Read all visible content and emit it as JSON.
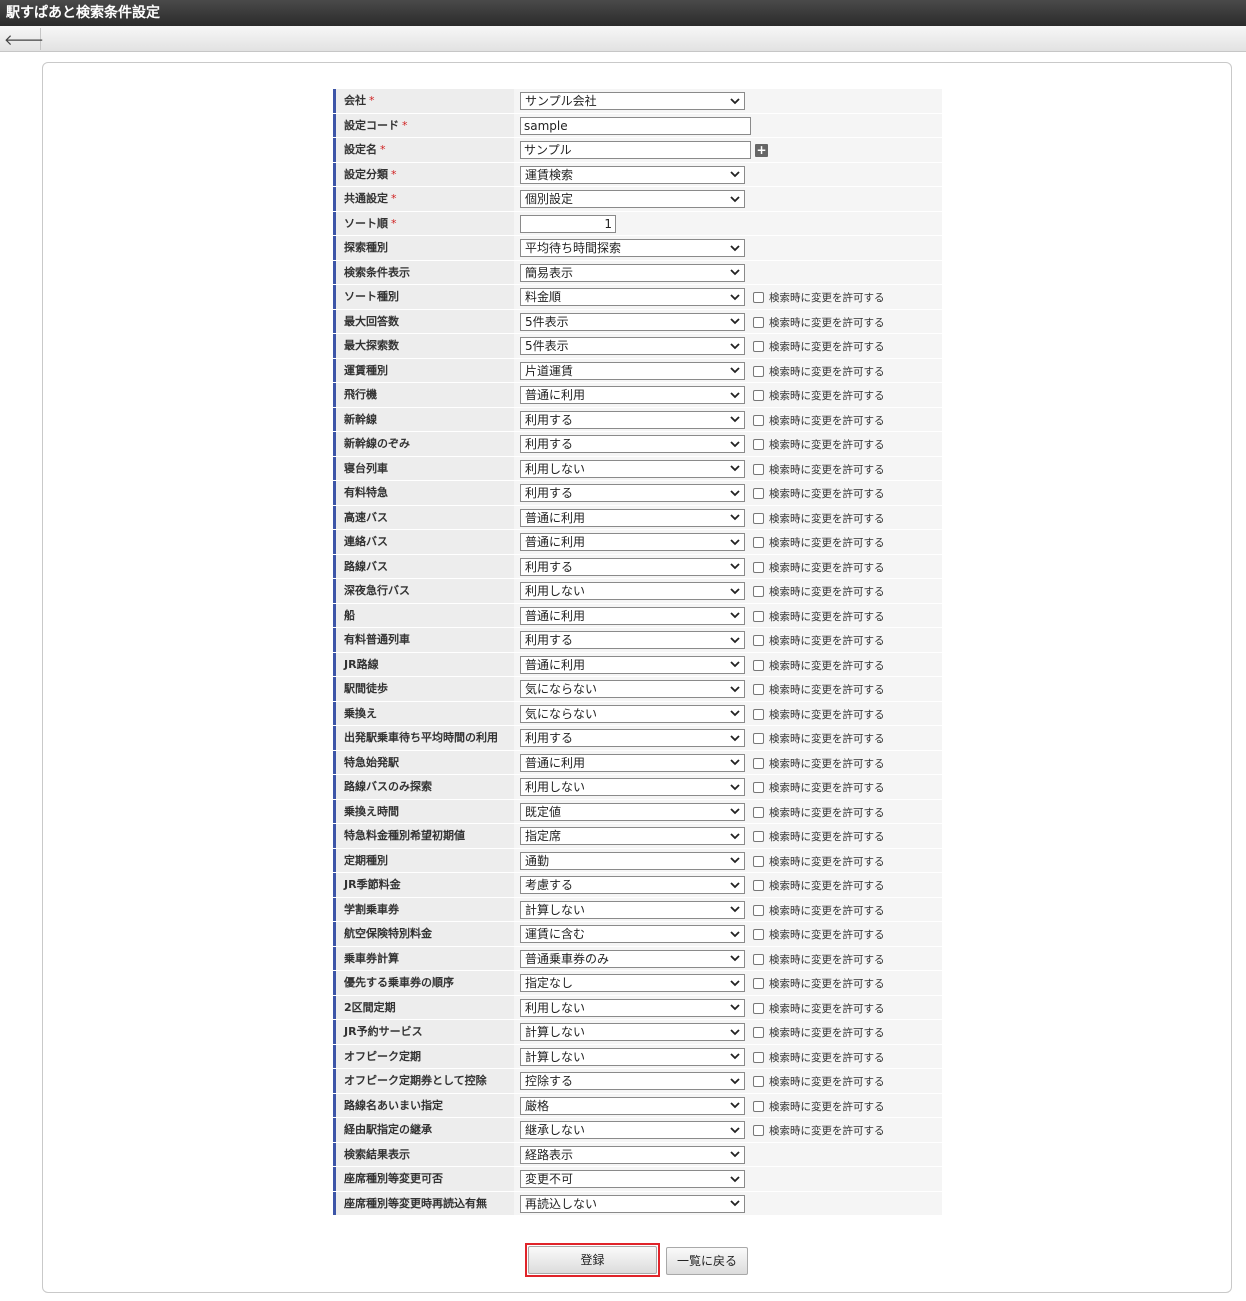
{
  "window": {
    "title": "駅すぱあと検索条件設定"
  },
  "toolbar": {
    "back_icon": "arrow-left-icon",
    "back_glyph": "🡐"
  },
  "allow_change_label": "検索時に変更を許可する",
  "rows": [
    {
      "label": "会社",
      "required": true,
      "type": "select",
      "value": "サンプル会社",
      "allow": false
    },
    {
      "label": "設定コード",
      "required": true,
      "type": "text",
      "value": "sample",
      "allow": false
    },
    {
      "label": "設定名",
      "required": true,
      "type": "text-plus",
      "value": "サンプル",
      "allow": false
    },
    {
      "label": "設定分類",
      "required": true,
      "type": "select",
      "value": "運賃検索",
      "allow": false
    },
    {
      "label": "共通設定",
      "required": true,
      "type": "select",
      "value": "個別設定",
      "allow": false
    },
    {
      "label": "ソート順",
      "required": true,
      "type": "number",
      "value": "1",
      "allow": false
    },
    {
      "label": "探索種別",
      "required": false,
      "type": "select",
      "value": "平均待ち時間探索",
      "allow": false
    },
    {
      "label": "検索条件表示",
      "required": false,
      "type": "select",
      "value": "簡易表示",
      "allow": false
    },
    {
      "label": "ソート種別",
      "required": false,
      "type": "select",
      "value": "料金順",
      "allow": true
    },
    {
      "label": "最大回答数",
      "required": false,
      "type": "select",
      "value": "5件表示",
      "allow": true
    },
    {
      "label": "最大探索数",
      "required": false,
      "type": "select",
      "value": "5件表示",
      "allow": true
    },
    {
      "label": "運賃種別",
      "required": false,
      "type": "select",
      "value": "片道運賃",
      "allow": true
    },
    {
      "label": "飛行機",
      "required": false,
      "type": "select",
      "value": "普通に利用",
      "allow": true
    },
    {
      "label": "新幹線",
      "required": false,
      "type": "select",
      "value": "利用する",
      "allow": true
    },
    {
      "label": "新幹線のぞみ",
      "required": false,
      "type": "select",
      "value": "利用する",
      "allow": true
    },
    {
      "label": "寝台列車",
      "required": false,
      "type": "select",
      "value": "利用しない",
      "allow": true
    },
    {
      "label": "有料特急",
      "required": false,
      "type": "select",
      "value": "利用する",
      "allow": true
    },
    {
      "label": "高速バス",
      "required": false,
      "type": "select",
      "value": "普通に利用",
      "allow": true
    },
    {
      "label": "連絡バス",
      "required": false,
      "type": "select",
      "value": "普通に利用",
      "allow": true
    },
    {
      "label": "路線バス",
      "required": false,
      "type": "select",
      "value": "利用する",
      "allow": true
    },
    {
      "label": "深夜急行バス",
      "required": false,
      "type": "select",
      "value": "利用しない",
      "allow": true
    },
    {
      "label": "船",
      "required": false,
      "type": "select",
      "value": "普通に利用",
      "allow": true
    },
    {
      "label": "有料普通列車",
      "required": false,
      "type": "select",
      "value": "利用する",
      "allow": true
    },
    {
      "label": "JR路線",
      "required": false,
      "type": "select",
      "value": "普通に利用",
      "allow": true
    },
    {
      "label": "駅間徒歩",
      "required": false,
      "type": "select",
      "value": "気にならない",
      "allow": true
    },
    {
      "label": "乗換え",
      "required": false,
      "type": "select",
      "value": "気にならない",
      "allow": true
    },
    {
      "label": "出発駅乗車待ち平均時間の利用",
      "required": false,
      "type": "select",
      "value": "利用する",
      "allow": true
    },
    {
      "label": "特急始発駅",
      "required": false,
      "type": "select",
      "value": "普通に利用",
      "allow": true
    },
    {
      "label": "路線バスのみ探索",
      "required": false,
      "type": "select",
      "value": "利用しない",
      "allow": true
    },
    {
      "label": "乗換え時間",
      "required": false,
      "type": "select",
      "value": "既定値",
      "allow": true
    },
    {
      "label": "特急料金種別希望初期値",
      "required": false,
      "type": "select",
      "value": "指定席",
      "allow": true
    },
    {
      "label": "定期種別",
      "required": false,
      "type": "select",
      "value": "通勤",
      "allow": true
    },
    {
      "label": "JR季節料金",
      "required": false,
      "type": "select",
      "value": "考慮する",
      "allow": true
    },
    {
      "label": "学割乗車券",
      "required": false,
      "type": "select",
      "value": "計算しない",
      "allow": true
    },
    {
      "label": "航空保険特別料金",
      "required": false,
      "type": "select",
      "value": "運賃に含む",
      "allow": true
    },
    {
      "label": "乗車券計算",
      "required": false,
      "type": "select",
      "value": "普通乗車券のみ",
      "allow": true
    },
    {
      "label": "優先する乗車券の順序",
      "required": false,
      "type": "select",
      "value": "指定なし",
      "allow": true
    },
    {
      "label": "2区間定期",
      "required": false,
      "type": "select",
      "value": "利用しない",
      "allow": true
    },
    {
      "label": "JR予約サービス",
      "required": false,
      "type": "select",
      "value": "計算しない",
      "allow": true
    },
    {
      "label": "オフピーク定期",
      "required": false,
      "type": "select",
      "value": "計算しない",
      "allow": true
    },
    {
      "label": "オフピーク定期券として控除",
      "required": false,
      "type": "select",
      "value": "控除する",
      "allow": true
    },
    {
      "label": "路線名あいまい指定",
      "required": false,
      "type": "select",
      "value": "厳格",
      "allow": true
    },
    {
      "label": "経由駅指定の継承",
      "required": false,
      "type": "select",
      "value": "継承しない",
      "allow": true
    },
    {
      "label": "検索結果表示",
      "required": false,
      "type": "select",
      "value": "経路表示",
      "allow": false
    },
    {
      "label": "座席種別等変更可否",
      "required": false,
      "type": "select",
      "value": "変更不可",
      "allow": false
    },
    {
      "label": "座席種別等変更時再読込有無",
      "required": false,
      "type": "select",
      "value": "再読込しない",
      "allow": false
    }
  ],
  "buttons": {
    "register": "登録",
    "back_to_list": "一覧に戻る"
  },
  "colors": {
    "label_accent": "#3d55a8",
    "required": "#d02020",
    "highlight": "#e0242a"
  }
}
